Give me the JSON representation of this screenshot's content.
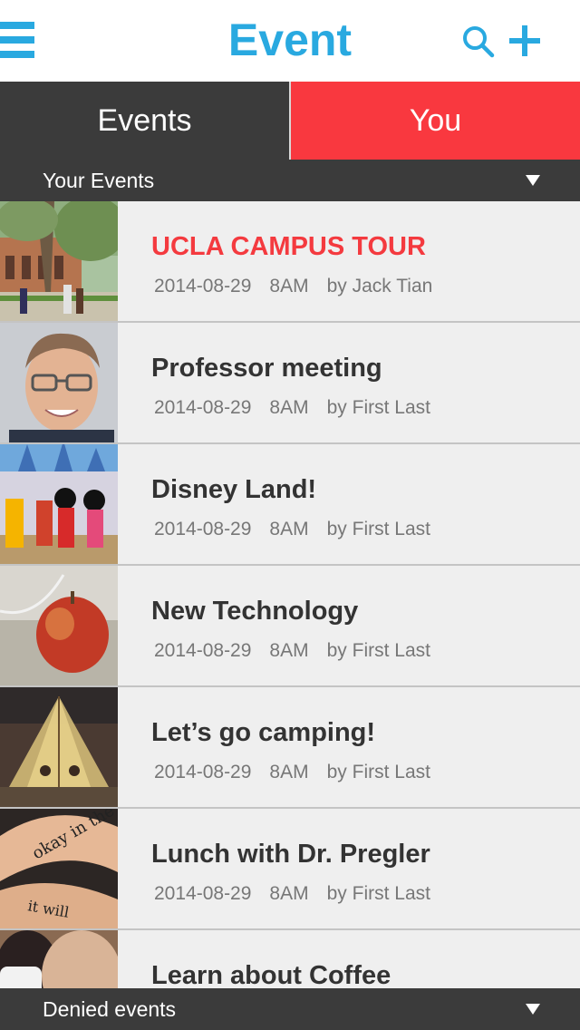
{
  "header": {
    "title": "Event",
    "accent_color": "#29a9e0",
    "icons": [
      "menu-icon",
      "search-icon",
      "add-icon"
    ]
  },
  "tabs": [
    {
      "label": "Events",
      "active": false
    },
    {
      "label": "You",
      "active": true,
      "color": "#f9383f"
    }
  ],
  "your_events_label": "Your Events",
  "denied_events_label": "Denied events",
  "events": [
    {
      "title": "UCLA CAMPUS TOUR",
      "date": "2014-08-29",
      "time": "8AM",
      "by": "by Jack Tian",
      "highlight": true
    },
    {
      "title": "Professor meeting",
      "date": "2014-08-29",
      "time": "8AM",
      "by": "by First Last"
    },
    {
      "title": "Disney Land!",
      "date": "2014-08-29",
      "time": "8AM",
      "by": "by First Last"
    },
    {
      "title": "New Technology",
      "date": "2014-08-29",
      "time": "8AM",
      "by": "by First Last"
    },
    {
      "title": "Let’s go camping!",
      "date": "2014-08-29",
      "time": "8AM",
      "by": "by First Last"
    },
    {
      "title": "Lunch with Dr. Pregler",
      "date": "2014-08-29",
      "time": "8AM",
      "by": "by First Last"
    },
    {
      "title": "Learn about Coffee",
      "date": "",
      "time": "",
      "by": ""
    }
  ]
}
